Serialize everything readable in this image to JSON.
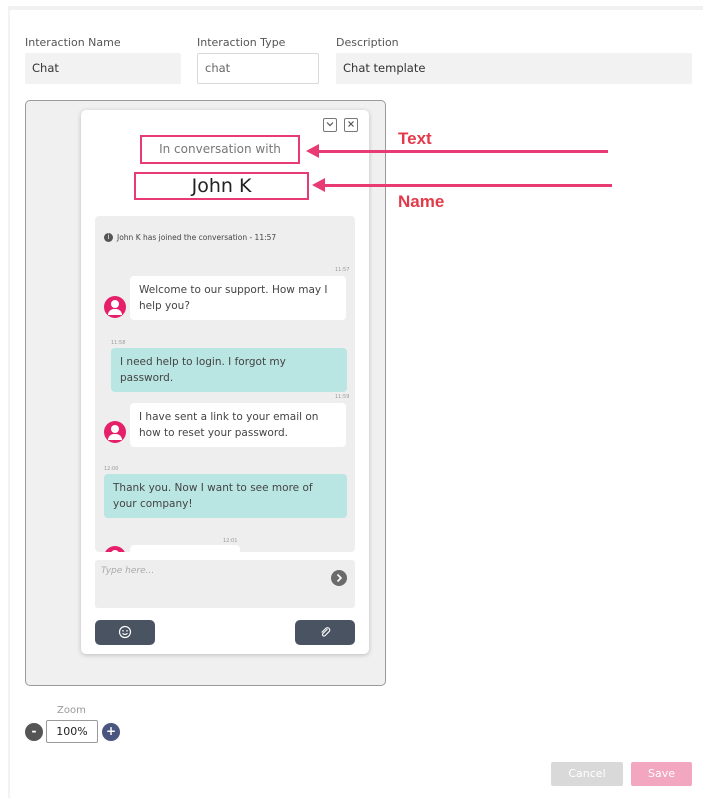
{
  "form": {
    "interaction_name": {
      "label": "Interaction Name",
      "value": "Chat"
    },
    "interaction_type": {
      "label": "Interaction Type",
      "value": "chat"
    },
    "description": {
      "label": "Description",
      "value": "Chat template"
    }
  },
  "widget": {
    "minimize_icon": "chevron-down-icon",
    "close_icon": "close-icon",
    "header_text": "In conversation with",
    "agent_name": "John K",
    "joined_text": "John K has joined the conversation - 11:57",
    "messages": [
      {
        "sender": "agent",
        "time": "11:57",
        "text": "Welcome to our support. How may I help you?"
      },
      {
        "sender": "user",
        "time": "11:58",
        "text": "I need help to login. I forgot my password."
      },
      {
        "sender": "agent",
        "time": "11:59",
        "text": "I have sent a link to your email on how to reset your password."
      },
      {
        "sender": "user",
        "time": "12:00",
        "text": "Thank you. Now I want to see more of your company!"
      },
      {
        "sender": "agent",
        "time": "12:01",
        "text": ""
      }
    ],
    "input_placeholder": "Type here...",
    "send_icon": "arrow-right-icon",
    "emoji_icon": "smiley-icon",
    "attach_icon": "paperclip-icon"
  },
  "annotations": {
    "text_label": "Text",
    "name_label": "Name",
    "accent_color": "#e83b73"
  },
  "zoom": {
    "label": "Zoom",
    "value": "100%",
    "minus": "-",
    "plus": "+"
  },
  "actions": {
    "cancel": "Cancel",
    "save": "Save"
  }
}
